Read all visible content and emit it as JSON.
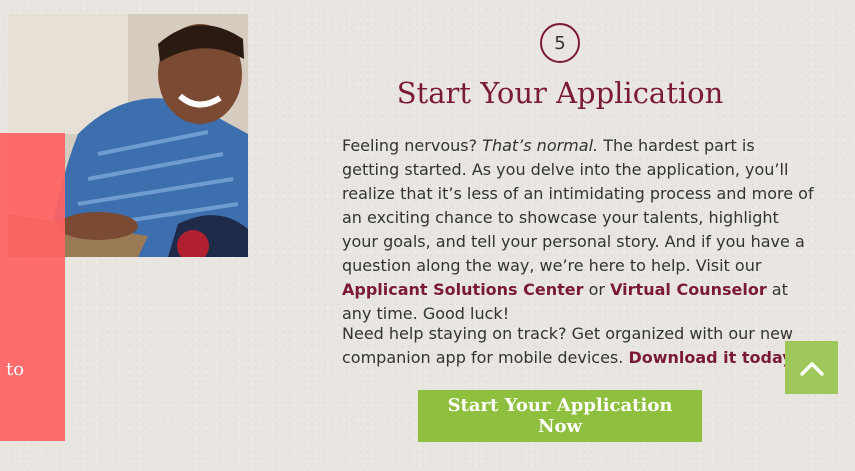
{
  "step": {
    "number": "5"
  },
  "heading": "Start Your Application",
  "intro": {
    "part1": "Feeling nervous? ",
    "emphasis": "That’s normal.",
    "part2": " The hardest part is getting started. As you delve into the application, you’ll realize that it’s less of an intimidating process and more of an exciting chance to showcase your talents, highlight your goals, and tell your personal story. And if you have a question along the way, we’re here to help. Visit our ",
    "link1": "Applicant Solutions Center",
    "part3": " or ",
    "link2": "Virtual Counselor",
    "part4": " at any time. Good luck!"
  },
  "app_promo": {
    "text": "Need help staying on track? Get organized with our new companion app for mobile devices. ",
    "link": "Download it today."
  },
  "cta_label": "Start Your Application Now",
  "side_promo_text": "to",
  "icons": {
    "back_to_top": "chevron-up-icon"
  },
  "colors": {
    "accent": "#7a1a35",
    "cta": "#8fbf3f",
    "back_to_top": "#9fc85a",
    "promo": "#ff6363"
  }
}
